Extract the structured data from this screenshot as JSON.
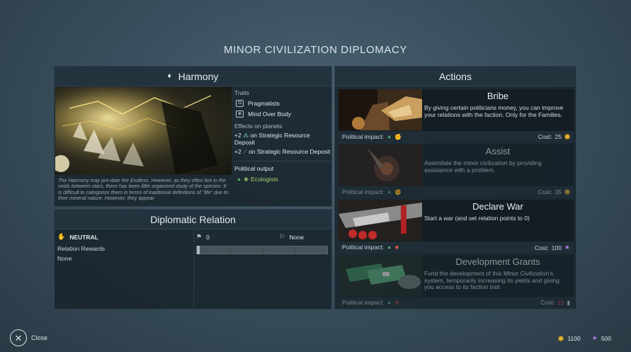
{
  "screen": {
    "title": "MINOR CIVILIZATION DIPLOMACY"
  },
  "faction": {
    "name": "Harmony",
    "description": "The Harmony may pre-date the Endless. However, as they often live in the voids between stars, there has been little organized study of the species. It is difficult to categorize them in terms of traditional definitions of \"life\" due to their mineral nature. However, they appear",
    "traits_label": "Traits",
    "traits": [
      "Pragmatists",
      "Mind Over Body"
    ],
    "effects_label": "Effects on planets",
    "effects": [
      {
        "amount": "+2",
        "text": "on Strategic Resource Deposit",
        "icon": "strategic-resource-icon"
      },
      {
        "amount": "+2",
        "text": "on Strategic Resource Deposit",
        "icon": "industry-icon"
      }
    ],
    "political_output_label": "Political output",
    "political_output": "Ecologists"
  },
  "relation": {
    "title": "Diplomatic Relation",
    "status": "NEUTRAL",
    "rewards_label": "Relation Rewards",
    "rewards_value": "None",
    "points": "0",
    "next": "None",
    "progress": 0
  },
  "actions": {
    "title": "Actions",
    "impact_label": "Political impact:",
    "cost_label": "Cost:",
    "items": [
      {
        "title": "Bribe",
        "desc": "By giving certain politicians money, you can improve your relations with the faction. Only for the Families.",
        "cost": "25",
        "currency": "dust",
        "impact_icon": "fist-icon",
        "enabled": true
      },
      {
        "title": "Assist",
        "desc": "Assimilate the minor civilization by providing assistance with a problem.",
        "cost": "35",
        "currency": "dust",
        "impact_icon": "fist-icon",
        "enabled": false
      },
      {
        "title": "Declare War",
        "desc": "Start a war (and set relation points to 0)",
        "cost": "100",
        "currency": "influence",
        "impact_icon": "flame-icon",
        "enabled": true
      },
      {
        "title": "Development Grants",
        "desc": "Fund the development of this Minor Civilization's system, temporarily increasing its yields and giving you access to its faction trait",
        "cost": "15",
        "currency": "industry",
        "impact_icon": "gear-icon",
        "enabled": false
      }
    ]
  },
  "footer": {
    "close_label": "Close",
    "dust": "1100",
    "influence": "500"
  },
  "colors": {
    "dust": "#e0b23c",
    "influence": "#b07be6",
    "positive": "#55c07a",
    "ecologists": "#a8cf6a",
    "insufficient": "#e04848"
  }
}
